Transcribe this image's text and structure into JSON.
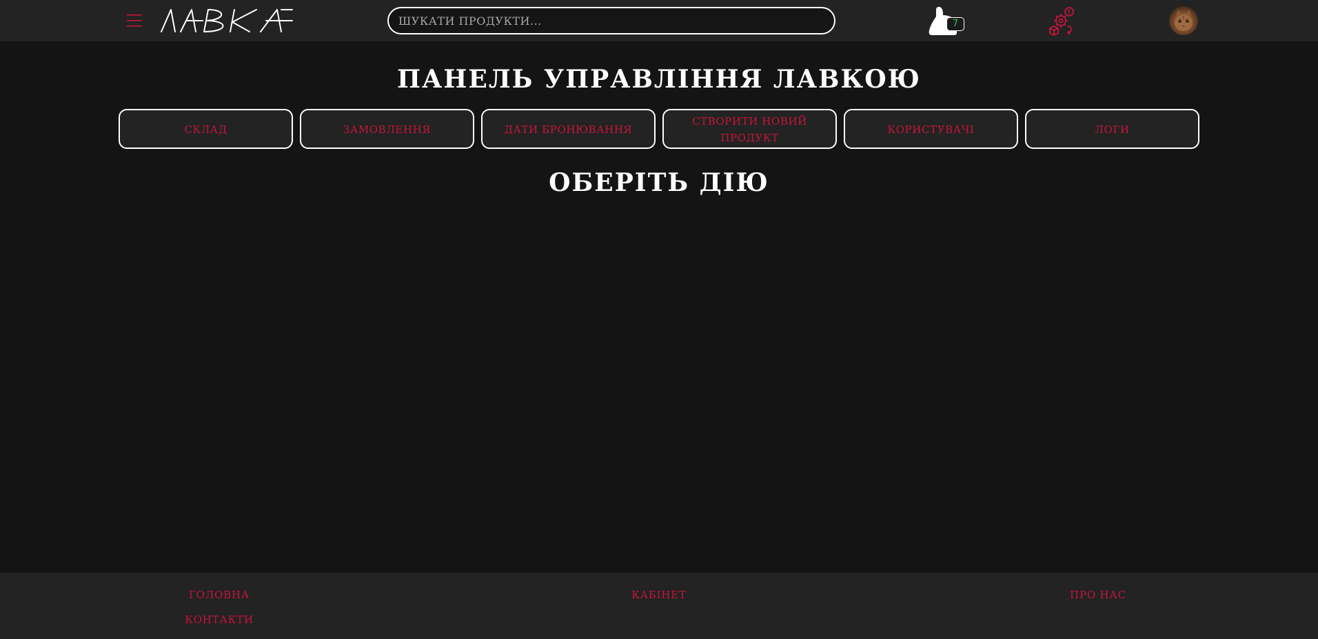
{
  "header": {
    "logo_text": "ЛАВКА",
    "search": {
      "placeholder": "ШУКАТИ ПРОДУКТИ...",
      "value": ""
    },
    "cart": {
      "count": "7",
      "icon": "cart-icon"
    },
    "orders_icon": "orders-icon",
    "menu_icon": "burger-menu-icon",
    "avatar_icon": "user-avatar"
  },
  "main": {
    "title": "ПАНЕЛЬ УПРАВЛІННЯ ЛАВКОЮ",
    "tabs": [
      {
        "label": "СКЛАД"
      },
      {
        "label": "ЗАМОВЛЕННЯ"
      },
      {
        "label": "ДАТИ БРОНЮВАННЯ"
      },
      {
        "label": "СТВОРИТИ НОВИЙ ПРОДУКТ"
      },
      {
        "label": "КОРИСТУВАЧІ"
      },
      {
        "label": "ЛОГИ"
      }
    ],
    "subtitle": "ОБЕРІТЬ ДІЮ"
  },
  "footer": {
    "links": [
      {
        "label": "ГОЛОВНА"
      },
      {
        "label": "КОНТАКТИ"
      },
      {
        "label": "КАБІНЕТ"
      },
      {
        "label": "ПРО НАС"
      }
    ]
  },
  "colors": {
    "accent": "#c8143c",
    "background": "#141414",
    "panel": "#232323",
    "badge_text": "#3fbf4a",
    "text": "#ffffff"
  }
}
